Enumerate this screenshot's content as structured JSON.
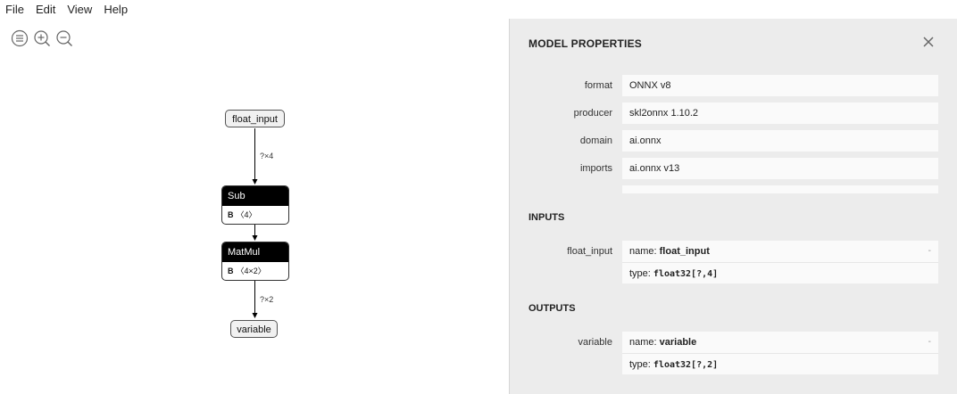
{
  "menu": {
    "file": "File",
    "edit": "Edit",
    "view": "View",
    "help": "Help"
  },
  "toolbar": {
    "icons": [
      "sidebar-icon",
      "zoom-in-icon",
      "zoom-out-icon"
    ]
  },
  "graph": {
    "input_node": "float_input",
    "edge1": "?×4",
    "sub": {
      "title": "Sub",
      "attr_name": "B",
      "attr_value": "〈4〉"
    },
    "matmul": {
      "title": "MatMul",
      "attr_name": "B",
      "attr_value": "〈4×2〉"
    },
    "edge2": "?×2",
    "output_node": "variable"
  },
  "sidebar": {
    "title": "MODEL PROPERTIES",
    "properties": [
      {
        "label": "format",
        "value": "ONNX v8"
      },
      {
        "label": "producer",
        "value": "skl2onnx 1.10.2"
      },
      {
        "label": "domain",
        "value": "ai.onnx"
      },
      {
        "label": "imports",
        "value": "ai.onnx v13"
      }
    ],
    "inputs_title": "INPUTS",
    "input": {
      "label": "float_input",
      "name_prefix": "name: ",
      "name": "float_input",
      "type_prefix": "type: ",
      "type": "float32[?,4]",
      "toggle": "-"
    },
    "outputs_title": "OUTPUTS",
    "output": {
      "label": "variable",
      "name_prefix": "name: ",
      "name": "variable",
      "type_prefix": "type: ",
      "type": "float32[?,2]",
      "toggle": "-"
    }
  },
  "colors": {
    "sidebar_bg": "#ececec",
    "node_header": "#000000",
    "value_bg": "#fafafa"
  }
}
